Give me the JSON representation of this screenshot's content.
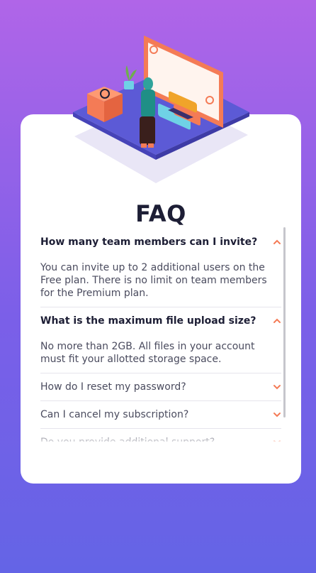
{
  "title": "FAQ",
  "accent_color": "#f47b56",
  "faqs": [
    {
      "question": "How many team members can I invite?",
      "answer": "You can invite up to 2 additional users on the Free plan. There is no limit on team members for the Premium plan.",
      "open": true
    },
    {
      "question": "What is the maximum file upload size?",
      "answer": "No more than 2GB. All files in your account must fit your allotted storage space.",
      "open": true
    },
    {
      "question": "How do I reset my password?",
      "answer": "",
      "open": false
    },
    {
      "question": "Can I cancel my subscription?",
      "answer": "",
      "open": false
    },
    {
      "question": "Do you provide additional support?",
      "answer": "",
      "open": false
    }
  ]
}
